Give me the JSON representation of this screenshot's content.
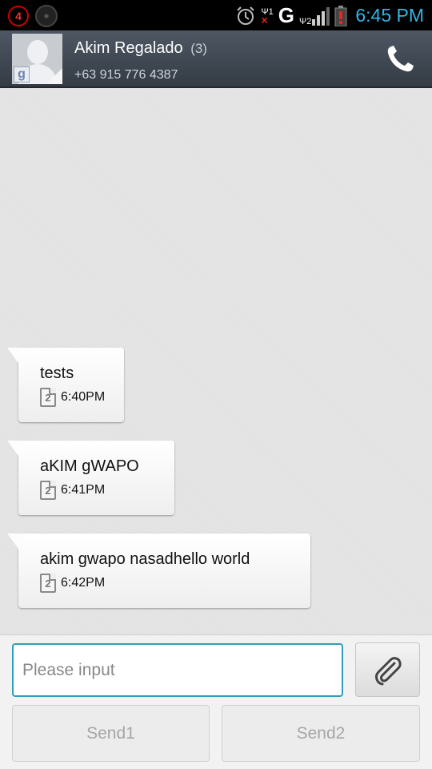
{
  "status_bar": {
    "notification_count": "4",
    "sim1_label": "1",
    "sim2_label": "2",
    "network_type": "G",
    "time": "6:45 PM",
    "accent_color": "#33b5e5"
  },
  "header": {
    "contact_name": "Akim Regalado",
    "message_count": "(3)",
    "phone_number": "+63 915 776 4387",
    "avatar_badge": "g",
    "call_icon": "phone-icon"
  },
  "messages": [
    {
      "text": "tests",
      "sim": "2",
      "time": "6:40PM"
    },
    {
      "text": "aKIM gWAPO",
      "sim": "2",
      "time": "6:41PM"
    },
    {
      "text": "akim gwapo nasadhello world",
      "sim": "2",
      "time": "6:42PM"
    }
  ],
  "composer": {
    "input_value": "",
    "input_placeholder": "Please input",
    "attach_icon": "paperclip-icon",
    "send1_label": "Send1",
    "send2_label": "Send2",
    "input_border_color": "#2f9fb8"
  }
}
